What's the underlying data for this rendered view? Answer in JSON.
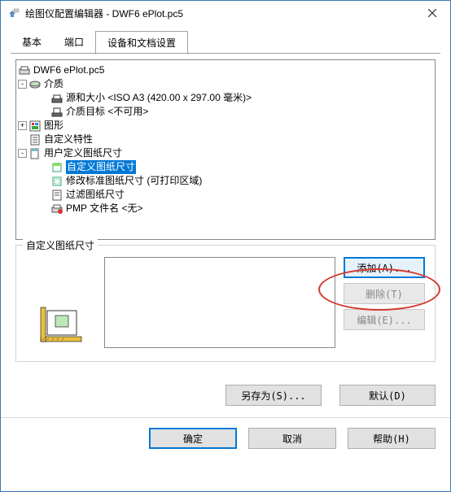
{
  "window": {
    "title": "绘图仪配置编辑器 - DWF6 ePlot.pc5"
  },
  "tabs": {
    "t1": "基本",
    "t2": "端口",
    "t3": "设备和文档设置"
  },
  "tree": {
    "root": "DWF6 ePlot.pc5",
    "media": "介质",
    "source_size": "源和大小 <ISO A3 (420.00 x 297.00 毫米)>",
    "media_target": "介质目标 <不可用>",
    "graphics": "图形",
    "custom_props": "自定义特性",
    "user_paper": "用户定义图纸尺寸",
    "custom_paper": "自定义图纸尺寸",
    "modify_std": "修改标准图纸尺寸 (可打印区域)",
    "filter_paper": "过滤图纸尺寸",
    "pmp": "PMP 文件名 <无>"
  },
  "group": {
    "title": "自定义图纸尺寸"
  },
  "buttons": {
    "add": "添加(A)...",
    "delete": "删除(T)",
    "edit": "编辑(E)...",
    "saveas": "另存为(S)...",
    "default": "默认(D)",
    "ok": "确定",
    "cancel": "取消",
    "help": "帮助(H)"
  }
}
